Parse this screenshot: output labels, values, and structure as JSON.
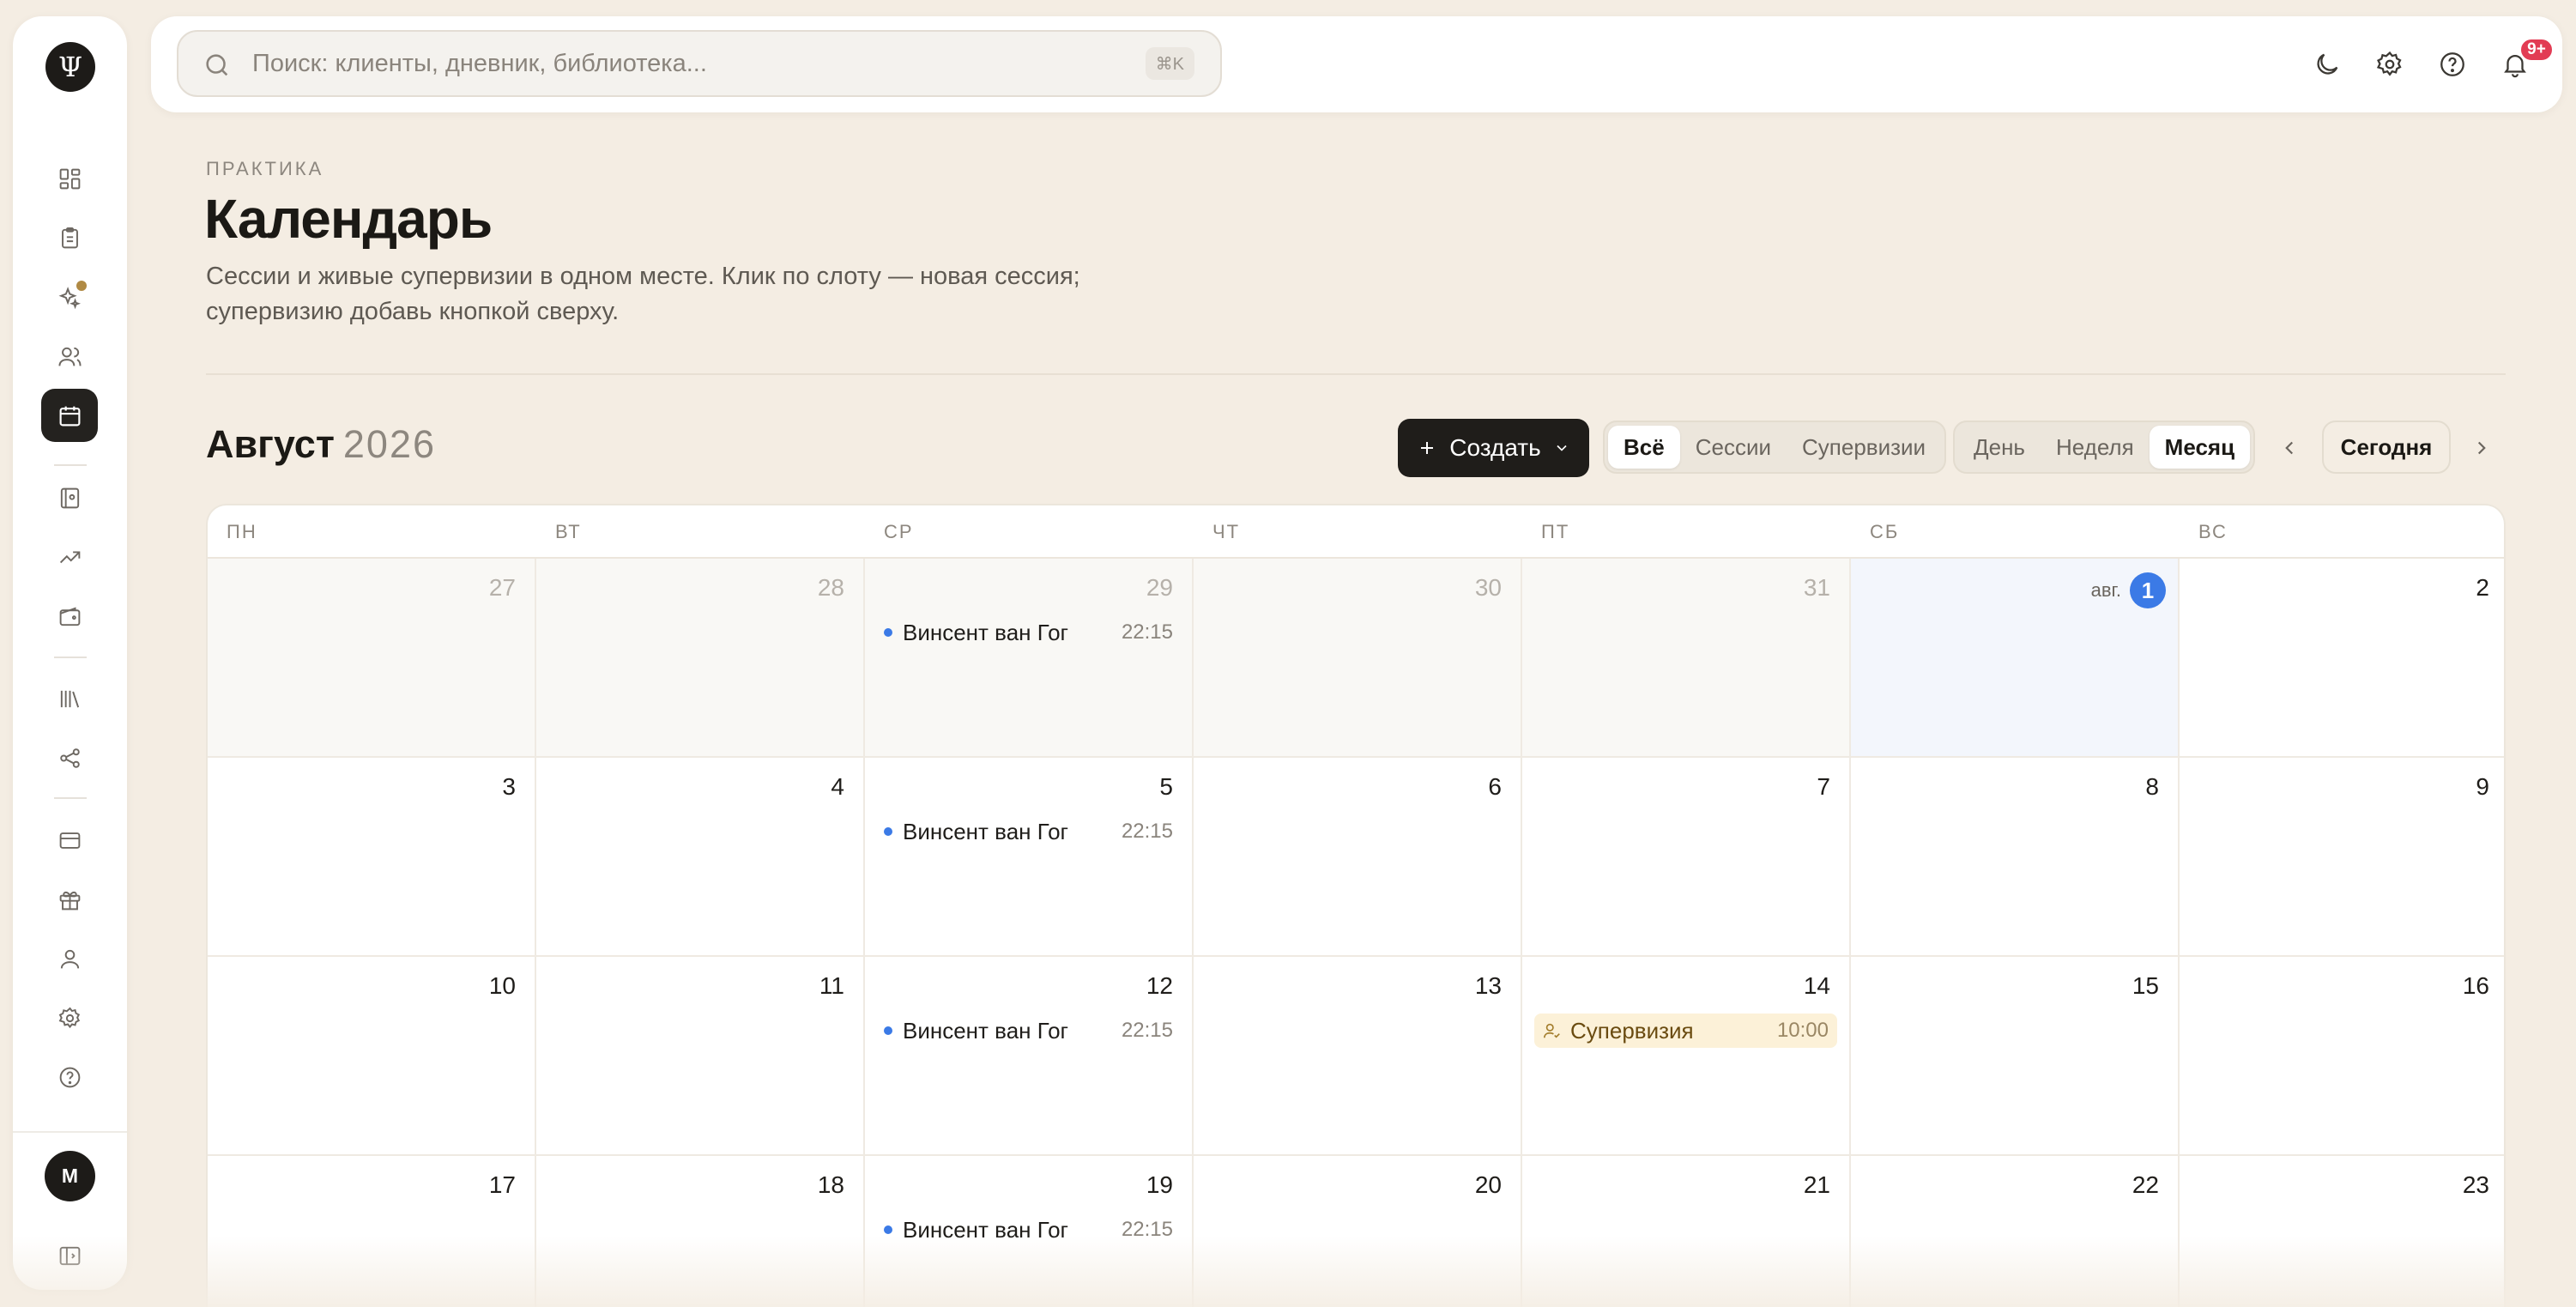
{
  "sidebar": {
    "logo": "Ψ",
    "avatar_initial": "M",
    "items": [
      {
        "name": "dashboard-icon"
      },
      {
        "name": "clipboard-icon"
      },
      {
        "name": "sparkles-icon"
      },
      {
        "name": "clients-icon"
      },
      {
        "name": "calendar-icon",
        "active": true
      },
      {
        "name": "journal-icon"
      },
      {
        "name": "trending-icon"
      },
      {
        "name": "wallet-icon"
      },
      {
        "name": "library-icon"
      },
      {
        "name": "share-icon"
      },
      {
        "name": "credit-card-icon"
      },
      {
        "name": "gift-icon"
      },
      {
        "name": "user-icon"
      },
      {
        "name": "gear-icon"
      },
      {
        "name": "help-icon"
      },
      {
        "name": "collapse-sidebar-icon"
      }
    ]
  },
  "topbar": {
    "search_placeholder": "Поиск: клиенты, дневник, библиотека...",
    "search_shortcut": "⌘K",
    "notifications_badge": "9+"
  },
  "header": {
    "eyebrow": "ПРАКТИКА",
    "title": "Календарь",
    "description": "Сессии и живые супервизии в одном месте. Клик по слоту — новая сессия; супервизию добавь кнопкой сверху."
  },
  "toolbar": {
    "month": "Август",
    "year": "2026",
    "create_label": "Создать",
    "filters": [
      "Всё",
      "Сессии",
      "Супервизии"
    ],
    "filter_active": "Всё",
    "views": [
      "День",
      "Неделя",
      "Месяц"
    ],
    "view_active": "Месяц",
    "today_label": "Сегодня"
  },
  "calendar": {
    "weekdays": [
      "ПН",
      "ВТ",
      "СР",
      "ЧТ",
      "ПТ",
      "СБ",
      "ВС"
    ],
    "today_month_label": "авг.",
    "weeks": [
      [
        {
          "day": "27",
          "other": true
        },
        {
          "day": "28",
          "other": true
        },
        {
          "day": "29",
          "other": true,
          "event": {
            "title": "Винсент ван Гог",
            "time": "22:15"
          }
        },
        {
          "day": "30",
          "other": true
        },
        {
          "day": "31",
          "other": true
        },
        {
          "day": "1",
          "today": true
        },
        {
          "day": "2"
        }
      ],
      [
        {
          "day": "3"
        },
        {
          "day": "4"
        },
        {
          "day": "5",
          "event": {
            "title": "Винсент ван Гог",
            "time": "22:15"
          }
        },
        {
          "day": "6"
        },
        {
          "day": "7"
        },
        {
          "day": "8"
        },
        {
          "day": "9"
        }
      ],
      [
        {
          "day": "10"
        },
        {
          "day": "11"
        },
        {
          "day": "12",
          "event": {
            "title": "Винсент ван Гог",
            "time": "22:15"
          }
        },
        {
          "day": "13"
        },
        {
          "day": "14",
          "event": {
            "title": "Супервизия",
            "time": "10:00",
            "supervision": true
          }
        },
        {
          "day": "15"
        },
        {
          "day": "16"
        }
      ],
      [
        {
          "day": "17"
        },
        {
          "day": "18"
        },
        {
          "day": "19",
          "event": {
            "title": "Винсент ван Гог",
            "time": "22:15"
          }
        },
        {
          "day": "20"
        },
        {
          "day": "21"
        },
        {
          "day": "22"
        },
        {
          "day": "23"
        }
      ]
    ]
  },
  "colors": {
    "background": "#f4ede3",
    "accent_blue": "#3b7ae6",
    "dark": "#1f1d1a",
    "badge_red": "#e23c54",
    "supervision_bg": "#fcf1d8"
  }
}
